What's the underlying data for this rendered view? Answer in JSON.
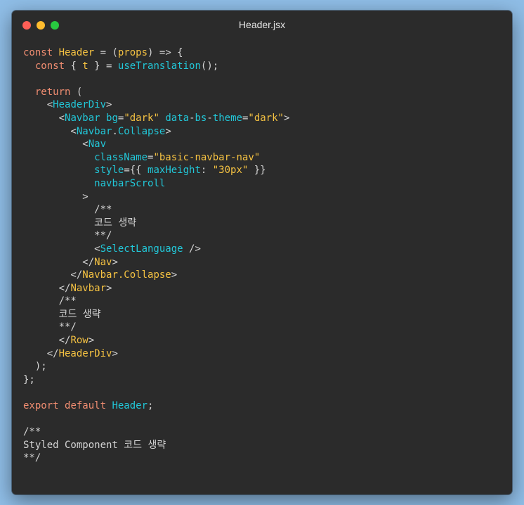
{
  "window": {
    "title": "Header.jsx"
  },
  "colors": {
    "background": "#8fbde6",
    "editor_bg": "#2b2b2b",
    "keyword": "#f08d71",
    "identifier": "#f5c242",
    "component": "#22c7d8",
    "string": "#f5c242",
    "plain": "#d4d4d4"
  },
  "code_lines": [
    [
      [
        "kw",
        "const "
      ],
      [
        "fn",
        "Header"
      ],
      [
        "plain",
        " = ("
      ],
      [
        "param",
        "props"
      ],
      [
        "plain",
        ") => {"
      ]
    ],
    [
      [
        "plain",
        "  "
      ],
      [
        "kw",
        "const "
      ],
      [
        "plain",
        "{ "
      ],
      [
        "param",
        "t"
      ],
      [
        "plain",
        " } = "
      ],
      [
        "call",
        "useTranslation"
      ],
      [
        "plain",
        "();"
      ]
    ],
    [],
    [
      [
        "plain",
        "  "
      ],
      [
        "kw",
        "return "
      ],
      [
        "plain",
        "("
      ]
    ],
    [
      [
        "plain",
        "    <"
      ],
      [
        "tag",
        "HeaderDiv"
      ],
      [
        "plain",
        ">"
      ]
    ],
    [
      [
        "plain",
        "      <"
      ],
      [
        "tag",
        "Navbar "
      ],
      [
        "attr",
        "bg"
      ],
      [
        "plain",
        "="
      ],
      [
        "str",
        "\"dark\""
      ],
      [
        "plain",
        " "
      ],
      [
        "attr",
        "data"
      ],
      [
        "plain",
        "-"
      ],
      [
        "attr",
        "bs"
      ],
      [
        "plain",
        "-"
      ],
      [
        "attr",
        "theme"
      ],
      [
        "plain",
        "="
      ],
      [
        "str",
        "\"dark\""
      ],
      [
        "plain",
        ">"
      ]
    ],
    [
      [
        "plain",
        "        <"
      ],
      [
        "tag",
        "Navbar"
      ],
      [
        "plain",
        "."
      ],
      [
        "tag",
        "Collapse"
      ],
      [
        "plain",
        ">"
      ]
    ],
    [
      [
        "plain",
        "          <"
      ],
      [
        "tag",
        "Nav"
      ]
    ],
    [
      [
        "plain",
        "            "
      ],
      [
        "attr",
        "className"
      ],
      [
        "plain",
        "="
      ],
      [
        "str",
        "\"basic-navbar-nav\""
      ]
    ],
    [
      [
        "plain",
        "            "
      ],
      [
        "attr",
        "style"
      ],
      [
        "plain",
        "={{ "
      ],
      [
        "attr",
        "maxHeight"
      ],
      [
        "plain",
        ": "
      ],
      [
        "str",
        "\"30px\""
      ],
      [
        "plain",
        " }}"
      ]
    ],
    [
      [
        "plain",
        "            "
      ],
      [
        "attr",
        "navbarScroll"
      ]
    ],
    [
      [
        "plain",
        "          >"
      ]
    ],
    [
      [
        "plain",
        "            /**"
      ]
    ],
    [
      [
        "plain",
        "            코드 생략"
      ]
    ],
    [
      [
        "plain",
        "            **/"
      ]
    ],
    [
      [
        "plain",
        "            <"
      ],
      [
        "tag",
        "SelectLanguage"
      ],
      [
        "plain",
        " />"
      ]
    ],
    [
      [
        "plain",
        "          </"
      ],
      [
        "ctag",
        "Nav"
      ],
      [
        "plain",
        ">"
      ]
    ],
    [
      [
        "plain",
        "        </"
      ],
      [
        "ctag",
        "Navbar.Collapse"
      ],
      [
        "plain",
        ">"
      ]
    ],
    [
      [
        "plain",
        "      </"
      ],
      [
        "ctag",
        "Navbar"
      ],
      [
        "plain",
        ">"
      ]
    ],
    [
      [
        "plain",
        "      /**"
      ]
    ],
    [
      [
        "plain",
        "      코드 생략"
      ]
    ],
    [
      [
        "plain",
        "      **/"
      ]
    ],
    [
      [
        "plain",
        "      </"
      ],
      [
        "ctag",
        "Row"
      ],
      [
        "plain",
        ">"
      ]
    ],
    [
      [
        "plain",
        "    </"
      ],
      [
        "ctag",
        "HeaderDiv"
      ],
      [
        "plain",
        ">"
      ]
    ],
    [
      [
        "plain",
        "  );"
      ]
    ],
    [
      [
        "plain",
        "};"
      ]
    ],
    [],
    [
      [
        "kw",
        "export "
      ],
      [
        "kw",
        "default "
      ],
      [
        "call",
        "Header"
      ],
      [
        "plain",
        ";"
      ]
    ],
    [],
    [
      [
        "plain",
        "/**"
      ]
    ],
    [
      [
        "plain",
        "Styled Component 코드 생략"
      ]
    ],
    [
      [
        "plain",
        "**/"
      ]
    ]
  ]
}
